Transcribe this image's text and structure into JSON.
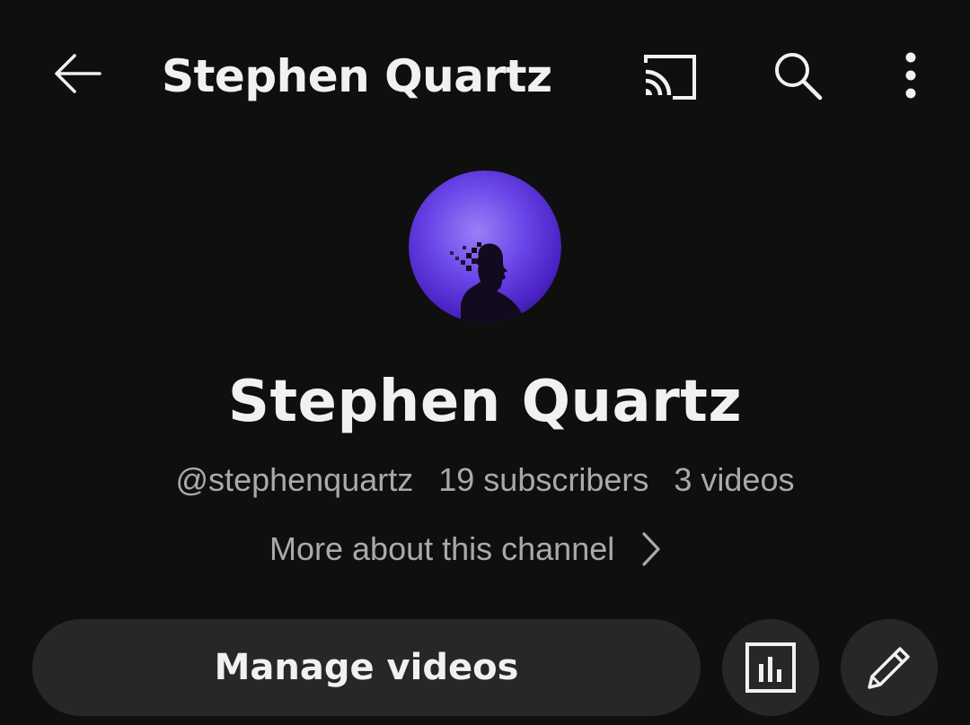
{
  "header": {
    "title": "Stephen Quartz",
    "icons": {
      "back": "arrow-left-icon",
      "cast": "cast-icon",
      "search": "search-icon",
      "more": "more-vertical-icon"
    }
  },
  "channel": {
    "name": "Stephen Quartz",
    "handle": "@stephenquartz",
    "subscribers": "19 subscribers",
    "videos": "3 videos",
    "more_about": "More about this channel",
    "avatar_colors": [
      "#8a6cf2",
      "#5a31d9",
      "#2a1570"
    ]
  },
  "actions": {
    "manage_videos": "Manage videos",
    "analytics_icon": "analytics-bar-chart-icon",
    "edit_icon": "pencil-icon"
  },
  "theme": {
    "background": "#0f0f0f",
    "surface": "#272727",
    "text_primary": "#f1f1f1",
    "text_secondary": "#aaaaaa"
  }
}
